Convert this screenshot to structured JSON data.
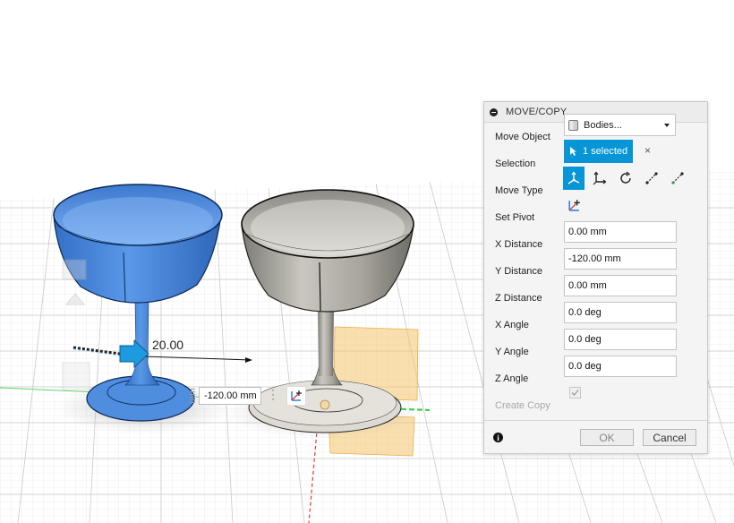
{
  "dimension_label": "20.00",
  "in_canvas_input": {
    "value": "-120.00 mm"
  },
  "dialog": {
    "title": "MOVE/COPY",
    "move_object": {
      "label": "Move Object",
      "value": "Bodies..."
    },
    "selection": {
      "label": "Selection",
      "value": "1 selected",
      "clear": "×"
    },
    "move_type": {
      "label": "Move Type",
      "icons": [
        "free-move-icon",
        "translate-icon",
        "rotate-icon",
        "point-to-point-icon",
        "point-to-position-icon"
      ]
    },
    "set_pivot": {
      "label": "Set Pivot"
    },
    "fields": [
      {
        "label": "X Distance",
        "value": "0.00 mm"
      },
      {
        "label": "Y Distance",
        "value": "-120.00 mm"
      },
      {
        "label": "Z Distance",
        "value": "0.00 mm"
      },
      {
        "label": "X Angle",
        "value": "0.0 deg"
      },
      {
        "label": "Y Angle",
        "value": "0.0 deg"
      },
      {
        "label": "Z Angle",
        "value": "0.0 deg"
      }
    ],
    "create_copy": {
      "label": "Create Copy",
      "checked": true
    },
    "ok_label": "OK",
    "cancel_label": "Cancel"
  },
  "colors": {
    "accent": "#0696d7",
    "selected_body": "#3f7fd6",
    "unselected_body": "#9a9890",
    "pivot_plane": "#f6c46b"
  }
}
